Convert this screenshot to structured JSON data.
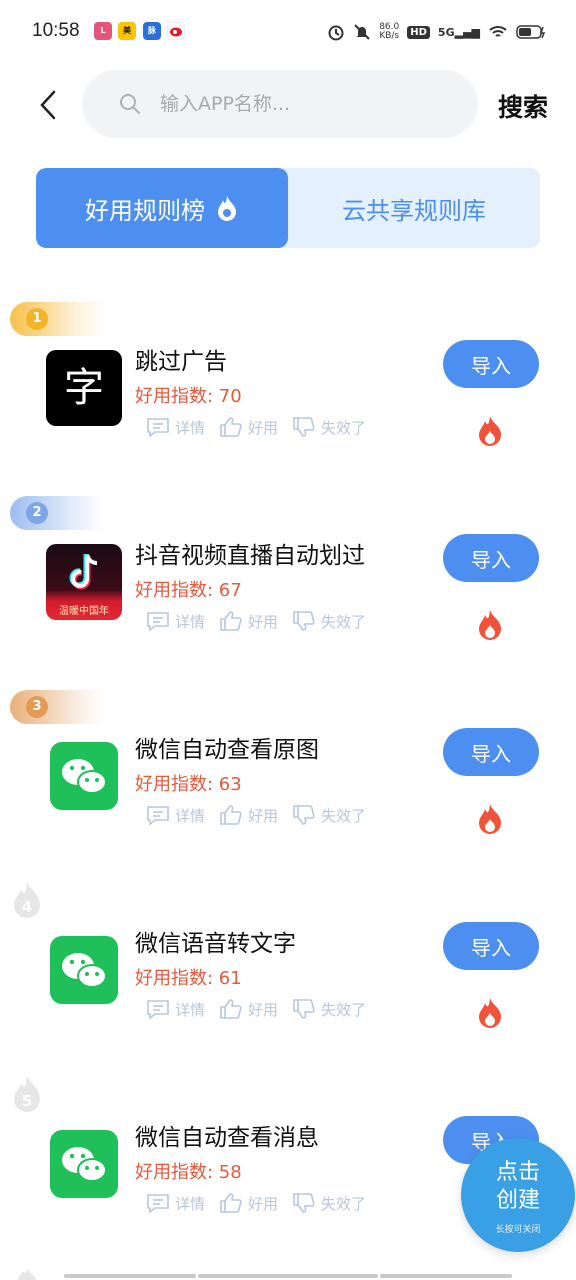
{
  "status_bar": {
    "time": "10:58",
    "notifications": [
      {
        "label": "Lala",
        "color": "#e8537a"
      },
      {
        "label": "美团",
        "color": "#ffc300"
      },
      {
        "label": "脉",
        "color": "#2a6fdb"
      },
      {
        "label": "微博",
        "color": "#e6162d"
      }
    ],
    "network_speed": "86.0",
    "network_unit": "KB/s",
    "hd": "HD",
    "signal": "5G"
  },
  "header": {
    "search_placeholder": "输入APP名称...",
    "search_button": "搜索"
  },
  "tabs": {
    "active": "好用规则榜",
    "inactive": "云共享规则库"
  },
  "actions_labels": {
    "detail": "详情",
    "good": "好用",
    "invalid": "失效了"
  },
  "import_label": "导入",
  "score_prefix": "好用指数: ",
  "items": [
    {
      "rank": "1",
      "title": "跳过广告",
      "score": "70",
      "app": "zi-app"
    },
    {
      "rank": "2",
      "title": "抖音视频直播自动划过",
      "score": "67",
      "app": "douyin",
      "app_caption": "温暖中国年"
    },
    {
      "rank": "3",
      "title": "微信自动查看原图",
      "score": "63",
      "app": "wechat"
    },
    {
      "rank": "4",
      "title": "微信语音转文字",
      "score": "61",
      "app": "wechat"
    },
    {
      "rank": "5",
      "title": "微信自动查看消息",
      "score": "58",
      "app": "wechat"
    }
  ],
  "fab": {
    "line1": "点击",
    "line2": "创建",
    "line3": "长按可关闭"
  },
  "colors": {
    "accent": "#4d8ff0",
    "score": "#e8593c",
    "fire": "#f0533a"
  }
}
